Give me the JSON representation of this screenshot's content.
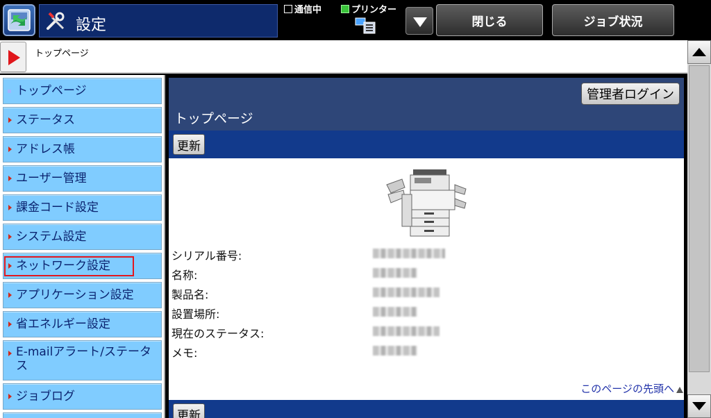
{
  "topbar": {
    "title": "設定",
    "status_comm": "通信中",
    "status_printer": "プリンター",
    "close_label": "閉じる",
    "job_status_label": "ジョブ状況"
  },
  "breadcrumb": {
    "text": "トップページ"
  },
  "sidebar": {
    "items": [
      {
        "label": "トップページ"
      },
      {
        "label": "ステータス"
      },
      {
        "label": "アドレス帳"
      },
      {
        "label": "ユーザー管理"
      },
      {
        "label": "課金コード設定"
      },
      {
        "label": "システム設定"
      },
      {
        "label": "ネットワーク設定"
      },
      {
        "label": "アプリケーション設定"
      },
      {
        "label": "省エネルギー設定"
      },
      {
        "label": "E-mailアラート/ステータス"
      },
      {
        "label": "ジョブログ"
      }
    ],
    "selected": "ネットワーク設定"
  },
  "main": {
    "admin_login": "管理者ログイン",
    "page_title": "トップページ",
    "refresh_label": "更新",
    "info": [
      {
        "label": "シリアル番号:"
      },
      {
        "label": "名称:"
      },
      {
        "label": "製品名:"
      },
      {
        "label": "設置場所:"
      },
      {
        "label": "現在のステータス:"
      },
      {
        "label": "メモ:"
      }
    ],
    "back_to_top": "このページの先頭へ",
    "refresh_label_bottom": "更新"
  },
  "colors": {
    "topbar_bg": "#000000",
    "title_panel": "#0e2a6c",
    "nav_item_bg": "#80ccff",
    "nav_text": "#0b2470",
    "panel_header": "#2e4678",
    "action_bar": "#123a8c",
    "selection_outline": "#e3171d",
    "link": "#2233aa"
  },
  "icons": {
    "home": "home-menu-icon",
    "settings": "wrench-screwdriver-icon",
    "printer_status": "printer-status-icon",
    "machine": "mfp-machine-icon"
  }
}
